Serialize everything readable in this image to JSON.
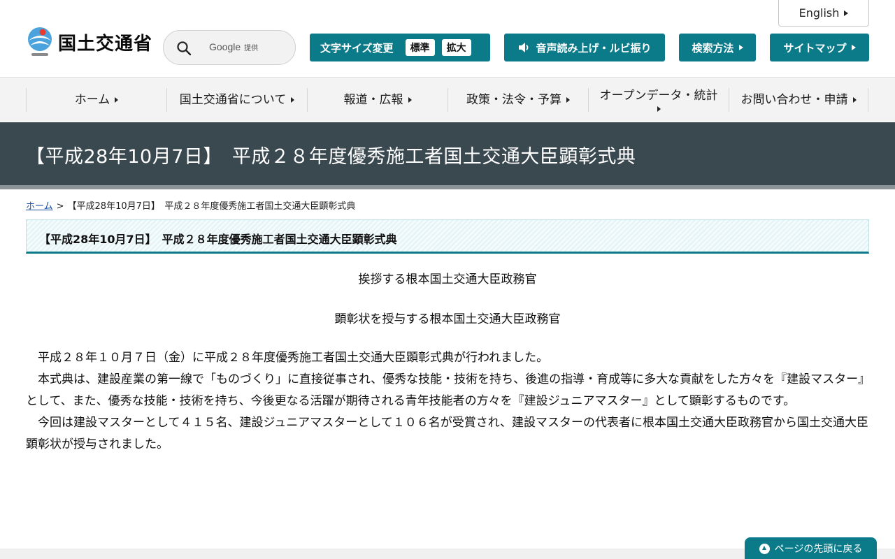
{
  "header": {
    "english_label": "English",
    "logo_text": "国土交通省",
    "search": {
      "brand": "Google",
      "provided": "提供"
    },
    "text_size": {
      "label": "文字サイズ変更",
      "standard": "標準",
      "large": "拡大"
    },
    "voice_label": "音声読み上げ・ルビ振り",
    "search_howto_label": "検索方法",
    "sitemap_label": "サイトマップ"
  },
  "nav": {
    "items": [
      {
        "label": "ホーム"
      },
      {
        "label": "国土交通省について"
      },
      {
        "label": "報道・広報"
      },
      {
        "label": "政策・法令・予算"
      },
      {
        "label": "オープンデータ・統計"
      },
      {
        "label": "お問い合わせ・申請"
      }
    ]
  },
  "page": {
    "title": "【平成28年10月7日】　平成２８年度優秀施工者国土交通大臣顕彰式典",
    "breadcrumb": {
      "home": "ホーム",
      "separator": ">",
      "current": "【平成28年10月7日】　平成２８年度優秀施工者国土交通大臣顕彰式典"
    },
    "section_heading": "【平成28年10月7日】　平成２８年度優秀施工者国土交通大臣顕彰式典",
    "captions": [
      "挨拶する根本国土交通大臣政務官",
      "顕彰状を授与する根本国土交通大臣政務官"
    ],
    "paragraphs": [
      "平成２８年１０月７日（金）に平成２８年度優秀施工者国土交通大臣顕彰式典が行われました。",
      "本式典は、建設産業の第一線で「ものづくり」に直接従事され、優秀な技能・技術を持ち、後進の指導・育成等に多大な貢献をした方々を『建設マスター』として、また、優秀な技能・技術を持ち、今後更なる活躍が期待される青年技能者の方々を『建設ジュニアマスター』として顕彰するものです。",
      "今回は建設マスターとして４１５名、建設ジュニアマスターとして１０６名が受賞され、建設マスターの代表者に根本国土交通大臣政務官から国土交通大臣顕彰状が授与されました。"
    ],
    "back_to_top": "ページの先頭に戻る"
  },
  "colors": {
    "accent": "#0b7a89",
    "title_band": "#3a4850",
    "nav_bg": "#f3f3f3"
  }
}
